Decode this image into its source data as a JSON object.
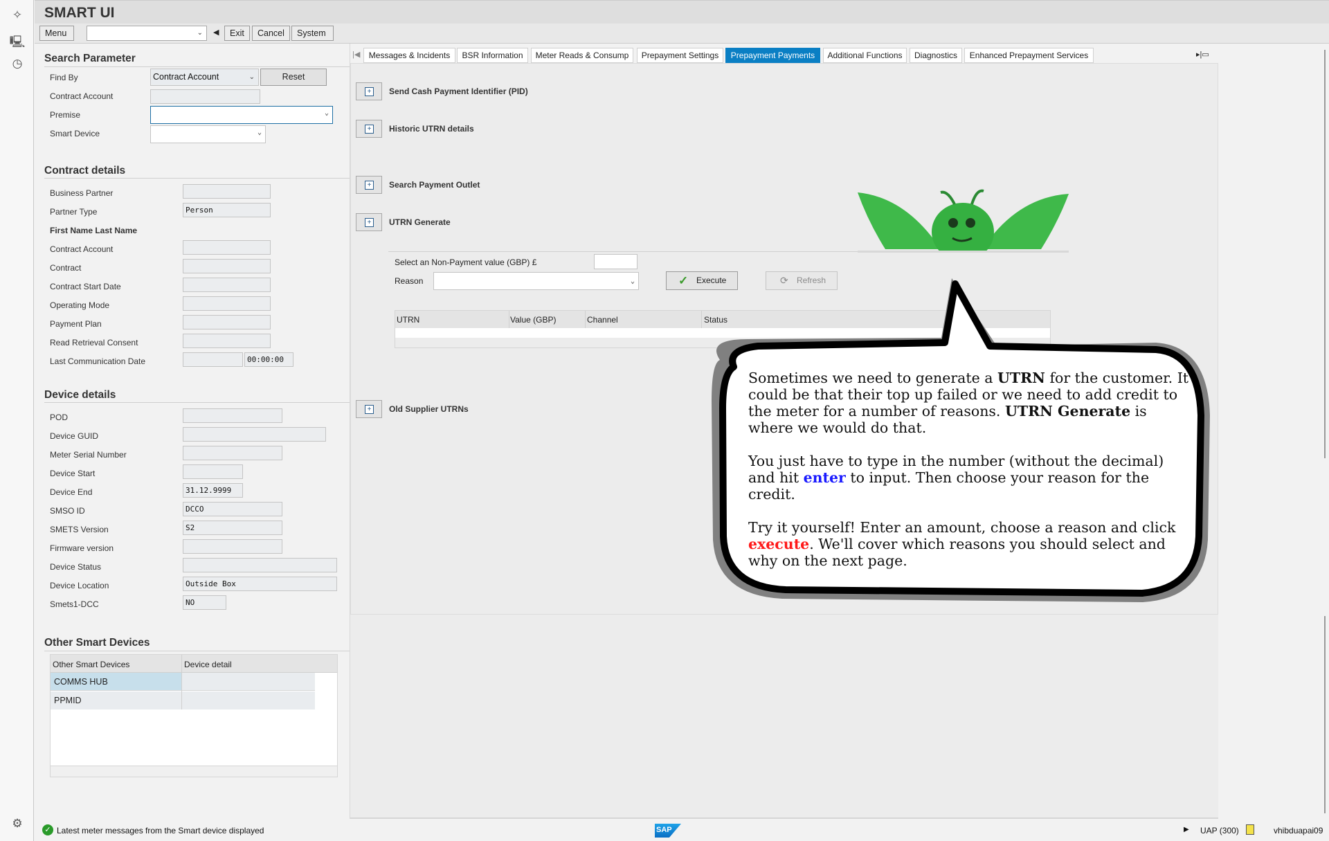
{
  "app": {
    "title": "SMART UI"
  },
  "toolbar": {
    "menu": "Menu",
    "command_value": "",
    "exit": "Exit",
    "cancel": "Cancel",
    "system": "System"
  },
  "search": {
    "heading": "Search Parameter",
    "find_by_label": "Find By",
    "find_by_value": "Contract Account",
    "reset": "Reset",
    "contract_account_label": "Contract Account",
    "contract_account_value": "",
    "premise_label": "Premise",
    "premise_value": "",
    "smart_device_label": "Smart Device",
    "smart_device_value": ""
  },
  "contract": {
    "heading": "Contract details",
    "rows": [
      {
        "label": "Business Partner",
        "value": ""
      },
      {
        "label": "Partner Type",
        "value": "Person"
      },
      {
        "label": "First Name Last Name",
        "bold": true
      },
      {
        "label": "Contract Account",
        "value": ""
      },
      {
        "label": "Contract",
        "value": ""
      },
      {
        "label": "Contract Start Date",
        "value": ""
      },
      {
        "label": "Operating Mode",
        "value": ""
      },
      {
        "label": "Payment Plan",
        "value": ""
      },
      {
        "label": "Read Retrieval Consent",
        "value": ""
      },
      {
        "label": "Last Communication Date",
        "value": "",
        "time": "00:00:00"
      }
    ]
  },
  "device": {
    "heading": "Device details",
    "rows": [
      {
        "label": "POD",
        "value": ""
      },
      {
        "label": "Device GUID",
        "value": ""
      },
      {
        "label": "Meter Serial Number",
        "value": ""
      },
      {
        "label": "Device Start",
        "value": ""
      },
      {
        "label": "Device End",
        "value": "31.12.9999"
      },
      {
        "label": "SMSO ID",
        "value": "DCCO"
      },
      {
        "label": "SMETS Version",
        "value": "S2"
      },
      {
        "label": "Firmware version",
        "value": ""
      },
      {
        "label": "Device Status",
        "value": ""
      },
      {
        "label": "Device Location",
        "value": "Outside Box"
      },
      {
        "label": "Smets1-DCC",
        "value": "NO"
      }
    ]
  },
  "other": {
    "heading": "Other Smart Devices",
    "columns": [
      "Other Smart Devices",
      "Device detail"
    ],
    "rows": [
      [
        "COMMS HUB",
        ""
      ],
      [
        "PPMID",
        ""
      ]
    ]
  },
  "tabs": [
    "Messages & Incidents",
    "BSR Information",
    "Meter Reads & Consump",
    "Prepayment Settings",
    "Prepayment Payments",
    "Additional Functions",
    "Diagnostics",
    "Enhanced Prepayment Services"
  ],
  "active_tab": 4,
  "actions": [
    "Send Cash Payment Identifier (PID)",
    "Historic UTRN details",
    "Search Payment Outlet",
    "UTRN Generate",
    "Old Supplier UTRNs"
  ],
  "utrn": {
    "value_label": "Select an Non-Payment value (GBP) £",
    "value": "",
    "reason_label": "Reason",
    "reason_value": "",
    "execute": "Execute",
    "refresh": "Refresh",
    "columns": [
      "UTRN",
      "Value (GBP)",
      "Channel",
      "Status"
    ]
  },
  "bubble": {
    "p1": [
      "Sometimes we need to generate a ",
      "UTRN",
      " for the customer. It could be that their top up failed or we need to add credit to the meter for a number of reasons. ",
      "UTRN Generate",
      " is where we would do that."
    ],
    "p2": [
      "You just have to type in the number (without the decimal) and hit ",
      "enter",
      " to input. Then choose your reason for the credit."
    ],
    "p3": [
      "Try it yourself! Enter an amount, choose a reason and click ",
      "execute",
      ". We'll cover which reasons you should select and why on the next page."
    ]
  },
  "status": {
    "message": "Latest meter messages from the Smart device displayed",
    "system": "UAP (300)",
    "user": "vhibduapai09",
    "logo": "SAP"
  },
  "colors": {
    "active_tab": "#0a7fc4",
    "enter": "#1a1aff",
    "execute": "#ff1a1a"
  }
}
